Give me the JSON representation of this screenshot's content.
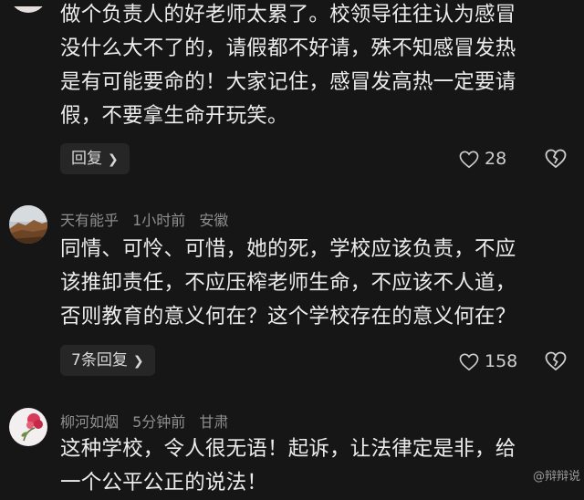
{
  "comments": [
    {
      "lines": [
        "做个负责人的好老师太累了。校领导往往认为感冒",
        "没什么大不了的，请假都不好请，殊不知感冒发热",
        "是有可能要命的！大家记住，感冒发高热一定要请",
        "假，不要拿生命开玩笑。"
      ],
      "reply_label": "回复",
      "likes": "28"
    },
    {
      "username": "天有能乎",
      "time": "1小时前",
      "location": "安徽",
      "lines": [
        "同情、可怜、可惜，她的死，学校应该负责，不应",
        "该推卸责任，不应压榨老师生命，不应该不人道，",
        "否则教育的意义何在？这个学校存在的意义何在？"
      ],
      "reply_label": "7条回复",
      "likes": "158"
    },
    {
      "username": "柳河如烟",
      "time": "5分钟前",
      "location": "甘肃",
      "lines": [
        "这种学校，令人很无语！起诉，让法律定是非，给",
        "一个公平公正的说法！"
      ]
    }
  ],
  "watermark": "@辩辩说"
}
